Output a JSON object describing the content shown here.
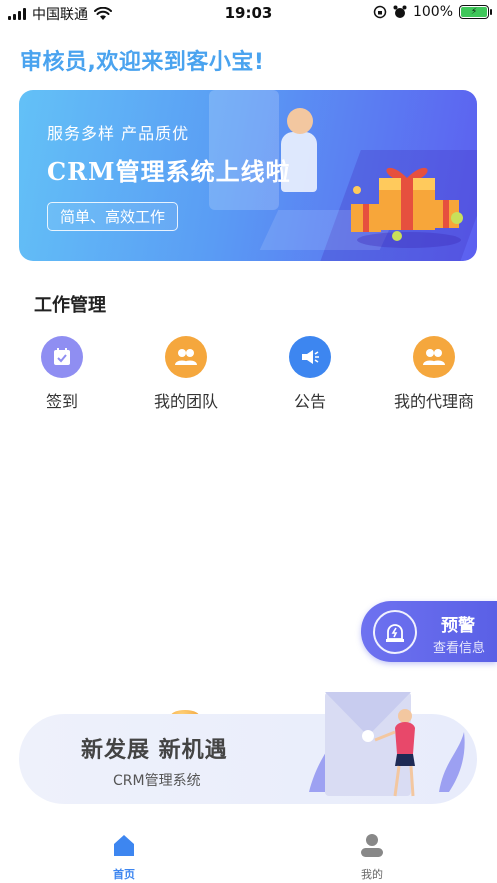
{
  "status_bar": {
    "carrier": "中国联通",
    "time": "19:03",
    "battery": "100%"
  },
  "welcome": "审核员,欢迎来到客小宝!",
  "banner": {
    "subtitle": "服务多样  产品质优",
    "title": "CRM管理系统上线啦",
    "button": "简单、高效工作"
  },
  "work": {
    "title": "工作管理",
    "items": [
      {
        "label": "签到",
        "icon": "calendar-check-icon",
        "color": "#8f8ef2"
      },
      {
        "label": "我的团队",
        "icon": "team-icon",
        "color": "#f5a73d"
      },
      {
        "label": "公告",
        "icon": "megaphone-icon",
        "color": "#3d86f0"
      },
      {
        "label": "我的代理商",
        "icon": "agent-icon",
        "color": "#f5a73d"
      }
    ]
  },
  "alert": {
    "title": "预警",
    "subtitle": "查看信息"
  },
  "promo": {
    "title": "新发展 新机遇",
    "subtitle": "CRM管理系统"
  },
  "tabbar": {
    "home": "首页",
    "mine": "我的",
    "active_color": "#3d86f0",
    "inactive_color": "#888888"
  }
}
